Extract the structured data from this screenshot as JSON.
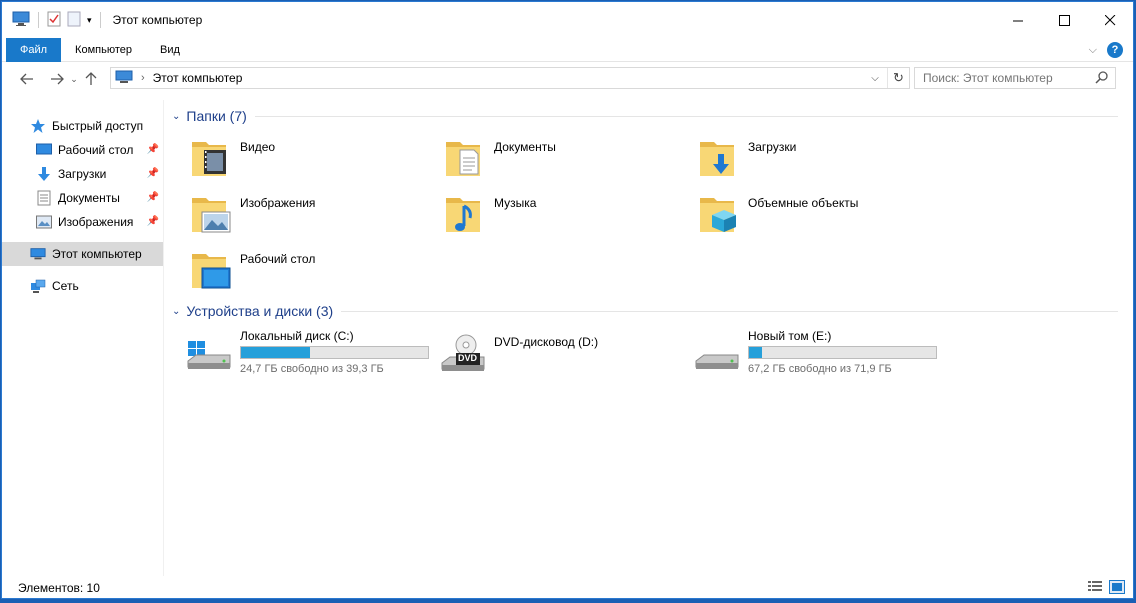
{
  "window": {
    "title": "Этот компьютер"
  },
  "ribbon": {
    "tabs": [
      "Файл",
      "Компьютер",
      "Вид"
    ],
    "help": "?"
  },
  "nav": {
    "address": "Этот компьютер",
    "search_placeholder": "Поиск: Этот компьютер"
  },
  "sidebar": {
    "items": [
      {
        "label": "Быстрый доступ",
        "icon": "star-icon"
      },
      {
        "label": "Рабочий стол",
        "icon": "desktop-icon"
      },
      {
        "label": "Загрузки",
        "icon": "download-icon"
      },
      {
        "label": "Документы",
        "icon": "document-icon"
      },
      {
        "label": "Изображения",
        "icon": "picture-icon"
      },
      {
        "label": "Этот компьютер",
        "icon": "computer-icon"
      },
      {
        "label": "Сеть",
        "icon": "network-icon"
      }
    ]
  },
  "folders": {
    "header": "Папки (7)",
    "items": [
      {
        "label": "Видео",
        "icon": "video-folder-icon"
      },
      {
        "label": "Документы",
        "icon": "documents-folder-icon"
      },
      {
        "label": "Загрузки",
        "icon": "downloads-folder-icon"
      },
      {
        "label": "Изображения",
        "icon": "pictures-folder-icon"
      },
      {
        "label": "Музыка",
        "icon": "music-folder-icon"
      },
      {
        "label": "Объемные объекты",
        "icon": "3d-objects-folder-icon"
      },
      {
        "label": "Рабочий стол",
        "icon": "desktop-folder-icon"
      }
    ]
  },
  "devices": {
    "header": "Устройства и диски (3)",
    "items": [
      {
        "label": "Локальный диск (C:)",
        "info": "24,7 ГБ свободно из 39,3 ГБ",
        "used_fraction": 0.37,
        "icon": "windows-drive-icon"
      },
      {
        "label": "DVD-дисковод (D:)",
        "info": "",
        "icon": "dvd-drive-icon",
        "dvd_label": "DVD"
      },
      {
        "label": "Новый том (E:)",
        "info": "67,2 ГБ свободно из 71,9 ГБ",
        "used_fraction": 0.07,
        "icon": "hard-drive-icon"
      }
    ]
  },
  "status": {
    "items_count": "Элементов: 10"
  },
  "colors": {
    "accent": "#1979ca",
    "drive_bar": "#26a0da",
    "group_title": "#1e3f8a",
    "folder": "#f8d775"
  }
}
